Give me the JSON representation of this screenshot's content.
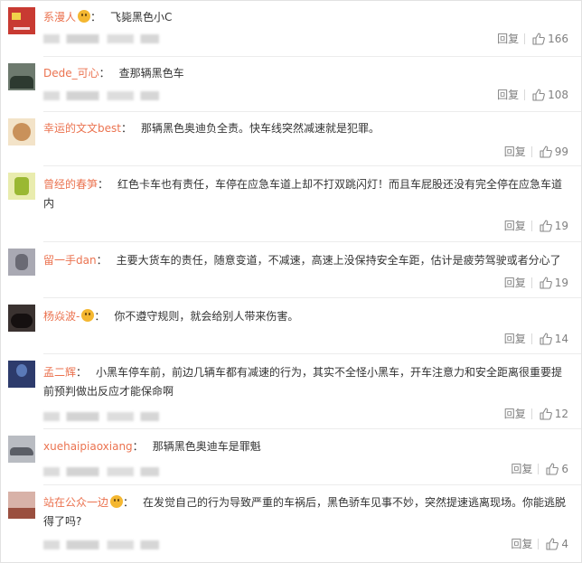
{
  "comments": [
    {
      "name": "系漫人",
      "text": "飞毙黑色小C",
      "reply": "回复",
      "likes": "166",
      "emoji": true,
      "avatar": {
        "bg": "#c83a32",
        "fg": "#f0d24a"
      }
    },
    {
      "name": "Dede_可心",
      "text": "查那辆黑色车",
      "reply": "回复",
      "likes": "108",
      "emoji": false,
      "avatar": {
        "bg": "#6d7a6e",
        "fg": "#2d3a30"
      }
    },
    {
      "name": "幸运的文文best",
      "text": "那辆黑色奥迪负全责。快车线突然减速就是犯罪。",
      "reply": "回复",
      "likes": "99",
      "emoji": false,
      "avatar": {
        "bg": "#f3e3c8",
        "fg": "#c9915a"
      }
    },
    {
      "name": "曾经的春笋",
      "text": "红色卡车也有责任，车停在应急车道上却不打双跳闪灯！而且车屁股还没有完全停在应急车道内",
      "reply": "回复",
      "likes": "19",
      "emoji": false,
      "avatar": {
        "bg": "#e9ecae",
        "fg": "#9ab832"
      }
    },
    {
      "name": "留一手dan",
      "text": "主要大货车的责任，随意变道，不减速，高速上没保持安全车距，估计是疲劳驾驶或者分心了",
      "reply": "回复",
      "likes": "19",
      "emoji": false,
      "avatar": {
        "bg": "#a9a9b3",
        "fg": "#6a6a74"
      }
    },
    {
      "name": "杨焱波-",
      "text": "你不遵守规则，就会给别人带来伤害。",
      "reply": "回复",
      "likes": "14",
      "emoji": true,
      "avatar": {
        "bg": "#3a3230",
        "fg": "#151010"
      }
    },
    {
      "name": "孟二辉",
      "text": "小黑车停车前，前边几辆车都有减速的行为，其实不全怪小黑车，开车注意力和安全距离很重要提前预判做出反应才能保命啊",
      "reply": "回复",
      "likes": "12",
      "emoji": false,
      "avatar": {
        "bg": "#2d3b6c",
        "fg": "#5a79b8"
      }
    },
    {
      "name": "xuehaipiaoxiang",
      "text": "那辆黑色奥迪车是罪魁",
      "reply": "回复",
      "likes": "6",
      "emoji": false,
      "avatar": {
        "bg": "#b9bcc2",
        "fg": "#5b5e66"
      }
    },
    {
      "name": "站在公众一边",
      "text": "在发觉自己的行为导致严重的车祸后，黑色骄车见事不妙，突然提速逃离现场。你能逃脱得了吗?",
      "reply": "回复",
      "likes": "4",
      "emoji": true,
      "avatar": {
        "bg": "#d8b2a8",
        "fg": "#9a4f3f"
      }
    }
  ]
}
